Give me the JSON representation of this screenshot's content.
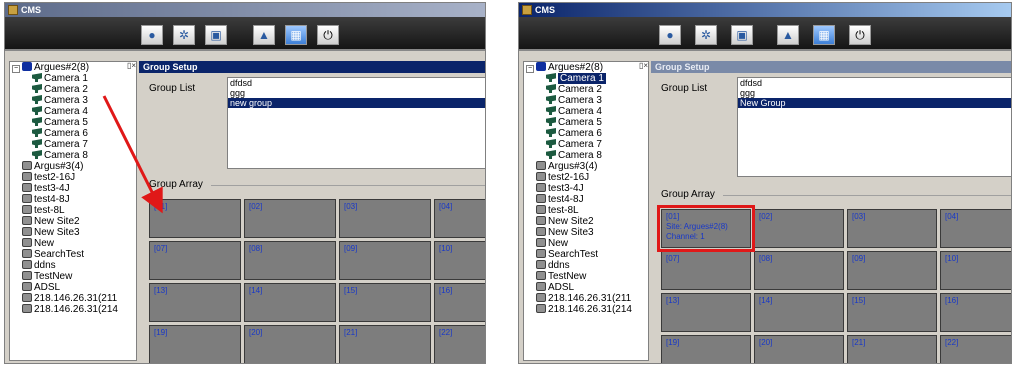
{
  "app": {
    "title": "CMS"
  },
  "toolbar": {
    "icons": [
      "camera-icon",
      "settings-icon",
      "monitor-icon",
      "group-icon",
      "grid-icon",
      "power-icon"
    ]
  },
  "tree": {
    "site1": {
      "label": "Argues#2(8)"
    },
    "cameras": [
      "Camera 1",
      "Camera 2",
      "Camera 3",
      "Camera 4",
      "Camera 5",
      "Camera 6",
      "Camera 7",
      "Camera 8"
    ],
    "sites": [
      "Argus#3(4)",
      "test2-16J",
      "test3-4J",
      "test4-8J",
      "test-8L",
      "New Site2",
      "New Site3",
      "New",
      "SearchTest",
      "ddns",
      "TestNew",
      "ADSL",
      "218.146.26.31(211",
      "218.146.26.31(214"
    ]
  },
  "panel": {
    "title": "Group Setup",
    "group_list_label": "Group List",
    "group_array_label": "Group Array"
  },
  "left": {
    "groups": [
      "dfdsd",
      "ggg",
      "new group"
    ],
    "selected_group": 2,
    "cells": [
      "[01]",
      "[02]",
      "[03]",
      "[04]",
      "[07]",
      "[08]",
      "[09]",
      "[10]",
      "[13]",
      "[14]",
      "[15]",
      "[16]",
      "[19]",
      "[20]",
      "[21]",
      "[22]"
    ]
  },
  "right": {
    "groups": [
      "dfdsd",
      "ggg",
      "New Group"
    ],
    "selected_group": 2,
    "first_cell": {
      "index": "[01]",
      "site": "Site: Argues#2(8)",
      "channel": "Channel: 1"
    },
    "cells": [
      "[02]",
      "[03]",
      "[04]",
      "[07]",
      "[08]",
      "[09]",
      "[10]",
      "[13]",
      "[14]",
      "[15]",
      "[16]",
      "[19]",
      "[20]",
      "[21]",
      "[22]"
    ]
  },
  "colors": {
    "highlight": "#e01818",
    "arrow": "#e01818",
    "cell_text": "#1838c8",
    "selection": "#0a246a"
  }
}
